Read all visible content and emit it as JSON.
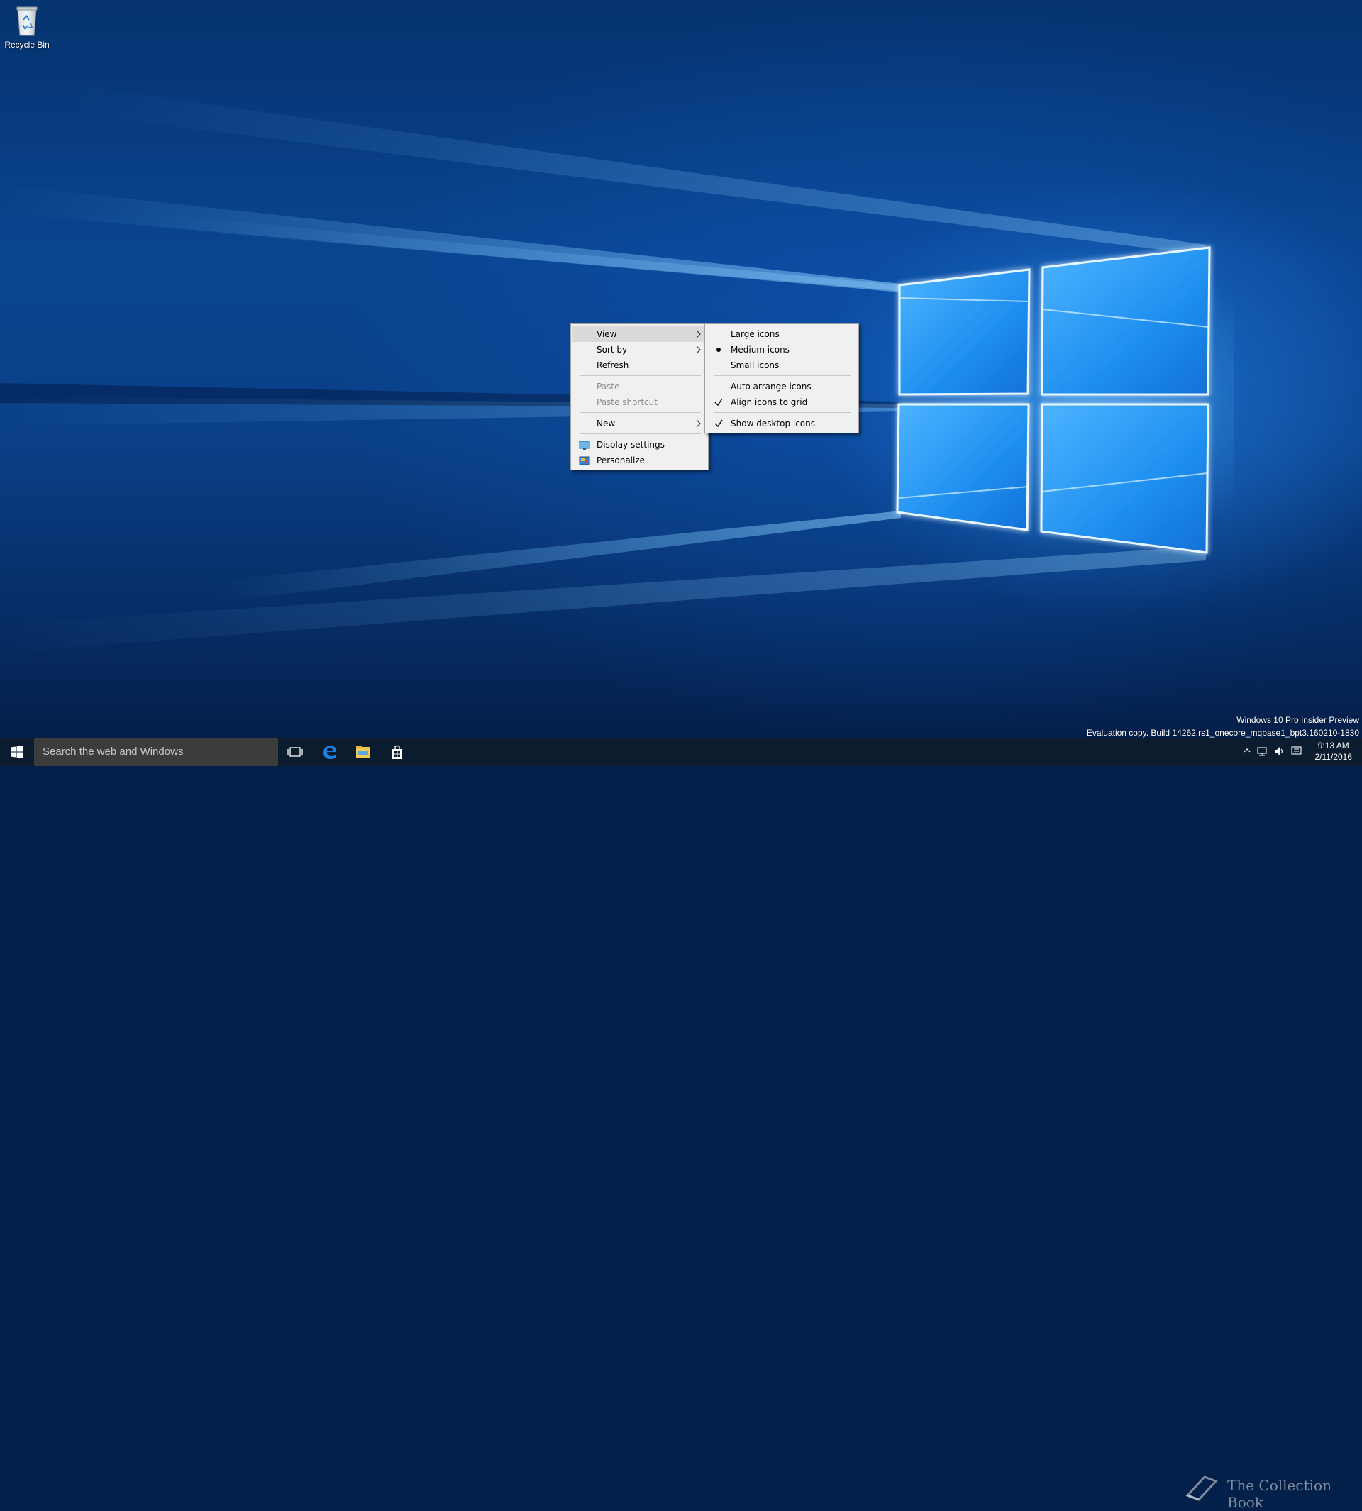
{
  "desktop": {
    "icons": [
      {
        "label": "Recycle Bin",
        "icon": "recycle-bin-icon"
      }
    ]
  },
  "context_menu": {
    "items": [
      {
        "label": "View",
        "submenu": true,
        "highlighted": true
      },
      {
        "label": "Sort by",
        "submenu": true
      },
      {
        "label": "Refresh"
      },
      {
        "label": "Paste",
        "disabled": true
      },
      {
        "label": "Paste shortcut",
        "disabled": true
      },
      {
        "label": "New",
        "submenu": true
      },
      {
        "label": "Display settings",
        "icon": "display-settings-icon"
      },
      {
        "label": "Personalize",
        "icon": "personalize-icon"
      }
    ]
  },
  "view_submenu": {
    "items": [
      {
        "label": "Large icons"
      },
      {
        "label": "Medium icons",
        "mark": "bullet"
      },
      {
        "label": "Small icons"
      },
      {
        "label": "Auto arrange icons"
      },
      {
        "label": "Align icons to grid",
        "mark": "check"
      },
      {
        "label": "Show desktop icons",
        "mark": "check"
      }
    ]
  },
  "watermark": {
    "edition": "Windows 10 Pro Insider Preview",
    "build": "Evaluation copy. Build 14262.rs1_onecore_mqbase1_bpt3.160210-1830"
  },
  "taskbar": {
    "search_placeholder": "Search the web and Windows",
    "pinned": [
      "task-view-icon",
      "edge-icon",
      "file-explorer-icon",
      "store-icon"
    ],
    "clock_time": "9:13 AM",
    "clock_date": "2/11/2016"
  },
  "overlay_logo_text": "The Collection Book",
  "colors": {
    "taskbar": "#0b1c2f",
    "search_box": "#3c3c3c",
    "menu_bg": "#f0f0f0",
    "menu_highlight": "#dadada",
    "accent": "#1a86ea"
  }
}
